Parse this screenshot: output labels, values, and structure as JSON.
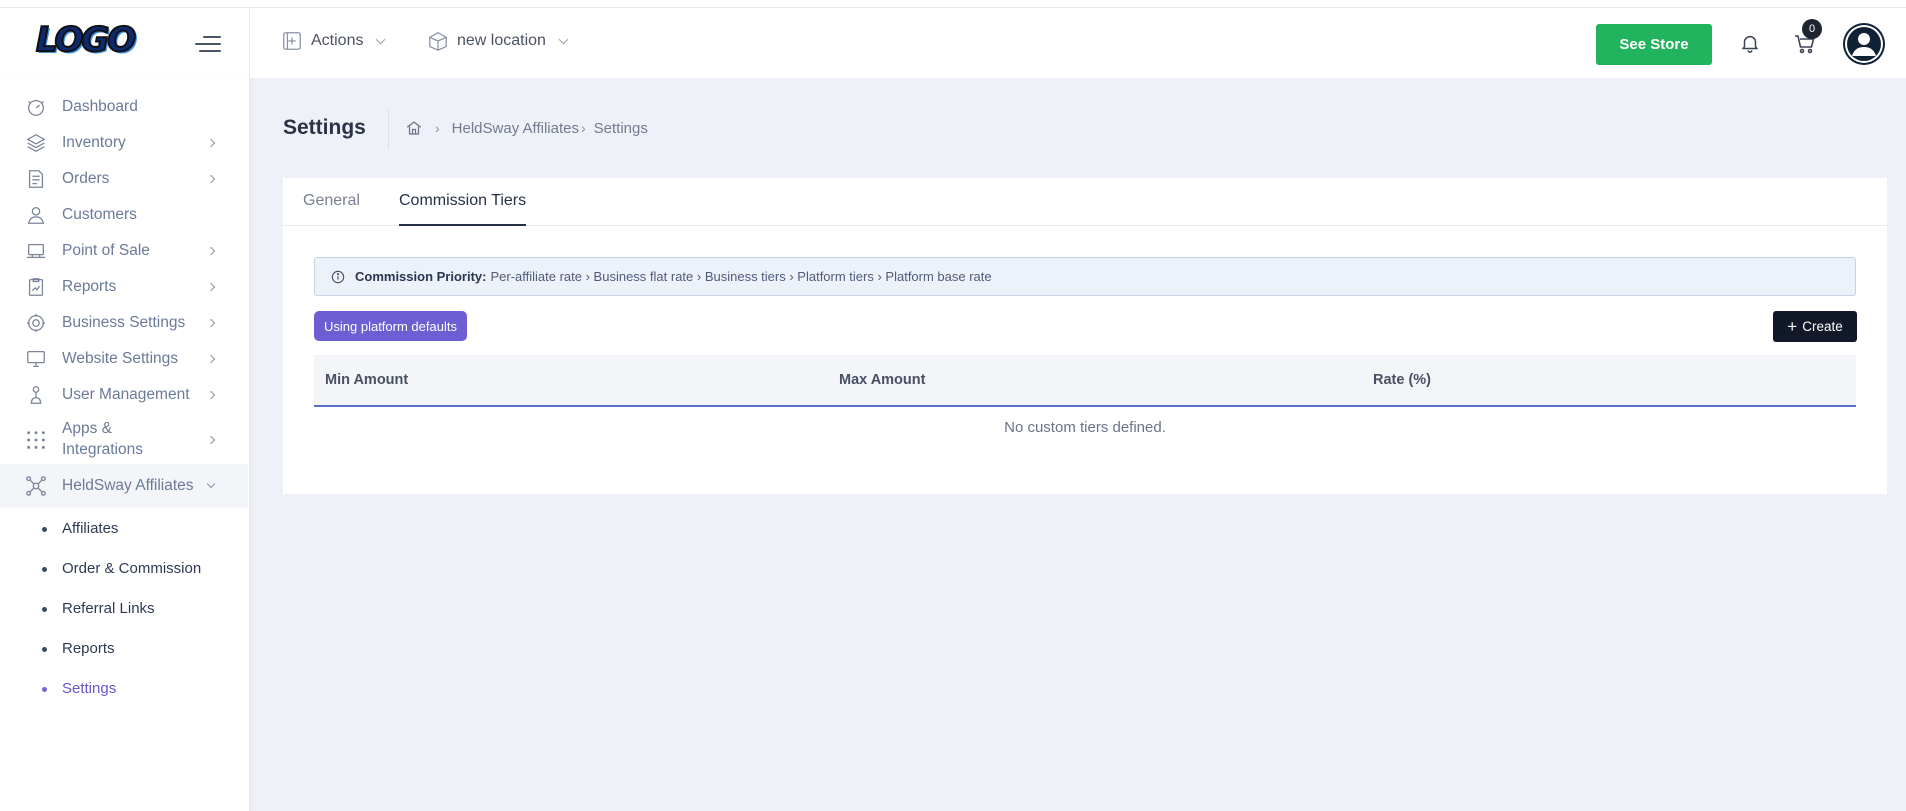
{
  "brand": {
    "logo_text": "LOGO"
  },
  "header": {
    "actions_label": "Actions",
    "location_label": "new location",
    "see_store_label": "See Store",
    "cart_count": "0"
  },
  "sidebar": {
    "items": [
      {
        "label": "Dashboard",
        "icon": "dashboard-icon",
        "has_chevron": false
      },
      {
        "label": "Inventory",
        "icon": "layers-icon",
        "has_chevron": true
      },
      {
        "label": "Orders",
        "icon": "document-icon",
        "has_chevron": true
      },
      {
        "label": "Customers",
        "icon": "user-icon",
        "has_chevron": false
      },
      {
        "label": "Point of Sale",
        "icon": "pos-icon",
        "has_chevron": true
      },
      {
        "label": "Reports",
        "icon": "report-icon",
        "has_chevron": true
      },
      {
        "label": "Business Settings",
        "icon": "gear-icon",
        "has_chevron": true
      },
      {
        "label": "Website Settings",
        "icon": "monitor-icon",
        "has_chevron": true
      },
      {
        "label": "User Management",
        "icon": "user-manage-icon",
        "has_chevron": true
      },
      {
        "label": "Apps &",
        "label2": "Integrations",
        "icon": "apps-grid-icon",
        "has_chevron": true
      },
      {
        "label": "HeldSway Affiliates",
        "icon": "network-icon",
        "has_chevron": true,
        "expanded": true
      }
    ],
    "sub_items": [
      {
        "label": "Affiliates"
      },
      {
        "label": "Order & Commission"
      },
      {
        "label": "Referral Links"
      },
      {
        "label": "Reports"
      },
      {
        "label": "Settings",
        "current": true
      }
    ]
  },
  "page": {
    "title": "Settings",
    "breadcrumb": [
      "HeldSway Affiliates",
      "Settings"
    ]
  },
  "tabs": [
    {
      "label": "General",
      "active": false
    },
    {
      "label": "Commission Tiers",
      "active": true
    }
  ],
  "notice": {
    "strong": "Commission Priority:",
    "text": "Per-affiliate rate › Business flat rate › Business tiers › Platform tiers › Platform base rate"
  },
  "status_pill": "Using platform defaults",
  "create_label": "Create",
  "table": {
    "columns": [
      "Min Amount",
      "Max Amount",
      "Rate (%)"
    ],
    "empty_text": "No custom tiers defined."
  },
  "colors": {
    "accent_green": "#22b35e",
    "pill_purple": "#6d5fd3",
    "primary_dark": "#111827",
    "active_sub": "#6a55c9"
  }
}
